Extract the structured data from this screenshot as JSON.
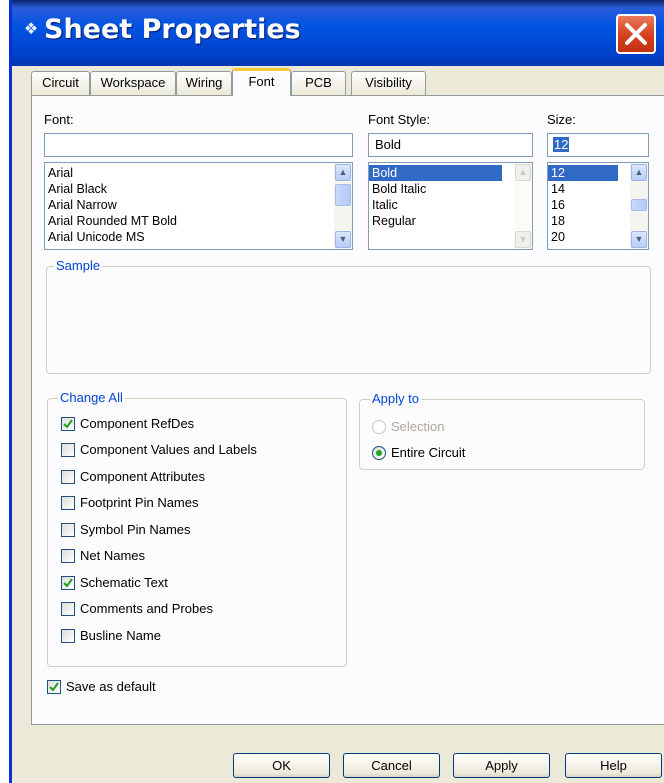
{
  "window": {
    "title": "Sheet Properties"
  },
  "tabs": [
    {
      "label": "Circuit",
      "active": false
    },
    {
      "label": "Workspace",
      "active": false
    },
    {
      "label": "Wiring",
      "active": false
    },
    {
      "label": "Font",
      "active": true
    },
    {
      "label": "PCB",
      "active": false
    },
    {
      "label": "Visibility",
      "active": false
    }
  ],
  "font": {
    "label": "Font:",
    "value": "",
    "items": [
      "Arial",
      "Arial Black",
      "Arial Narrow",
      "Arial Rounded MT Bold",
      "Arial Unicode MS"
    ]
  },
  "font_style": {
    "label": "Font Style:",
    "value": "Bold",
    "items": [
      "Bold",
      "Bold Italic",
      "Italic",
      "Regular"
    ],
    "selected": "Bold"
  },
  "size": {
    "label": "Size:",
    "value": "12",
    "items": [
      "12",
      "14",
      "16",
      "18",
      "20"
    ],
    "selected": "12"
  },
  "sample": {
    "legend": "Sample"
  },
  "change_all": {
    "legend": "Change All",
    "items": [
      {
        "label": "Component RefDes",
        "checked": true
      },
      {
        "label": "Component Values and Labels",
        "checked": false
      },
      {
        "label": "Component Attributes",
        "checked": false
      },
      {
        "label": "Footprint Pin Names",
        "checked": false
      },
      {
        "label": "Symbol Pin Names",
        "checked": false
      },
      {
        "label": "Net Names",
        "checked": false
      },
      {
        "label": "Schematic Text",
        "checked": true
      },
      {
        "label": "Comments and Probes",
        "checked": false
      },
      {
        "label": "Busline Name",
        "checked": false
      }
    ]
  },
  "apply_to": {
    "legend": "Apply to",
    "options": [
      {
        "label": "Selection",
        "selected": false,
        "disabled": true
      },
      {
        "label": "Entire Circuit",
        "selected": true,
        "disabled": false
      }
    ]
  },
  "save_default": {
    "label": "Save as default",
    "checked": true
  },
  "buttons": {
    "ok": "OK",
    "cancel": "Cancel",
    "apply": "Apply",
    "help": "Help"
  },
  "colors": {
    "titlebar": "#0054e3",
    "dialog_bg": "#ece9d8",
    "selection": "#316ac5",
    "group_legend": "#0046d5",
    "close_button": "#d5401f",
    "active_tab_accent": "#ffc83c"
  },
  "icons": {
    "title": "app-icon",
    "close": "close-icon",
    "scroll_up": "chevron-up-icon",
    "scroll_down": "chevron-down-icon",
    "check": "checkmark-icon"
  }
}
